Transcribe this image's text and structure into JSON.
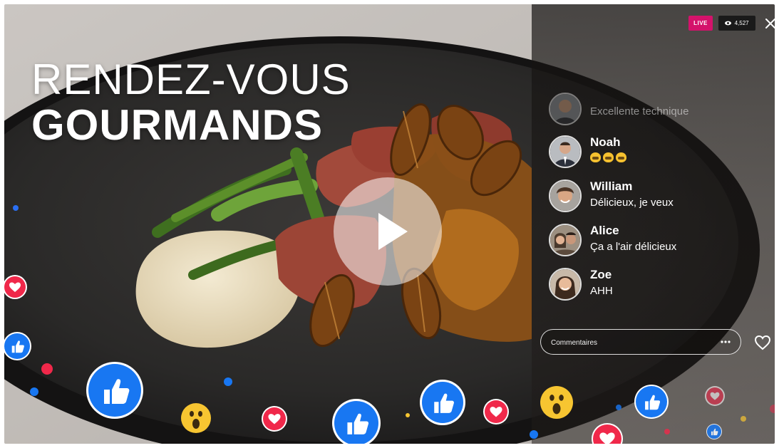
{
  "headline": {
    "line1": "RENDEZ-VOUS",
    "line2": "GOURMANDS"
  },
  "live_panel": {
    "live_badge": "LIVE",
    "viewer_count": "4,527",
    "comments": [
      {
        "name": "",
        "text": "Excellente technique",
        "avatar": "avatar-man-beard"
      },
      {
        "name": "Noah",
        "text": "",
        "emoji": [
          "grinning-emoji",
          "grinning-emoji",
          "grinning-emoji"
        ],
        "avatar": "avatar-man-suit"
      },
      {
        "name": "William",
        "text": "Délicieux, je veux",
        "avatar": "avatar-man-curly"
      },
      {
        "name": "Alice",
        "text": "Ça a l'air délicieux",
        "avatar": "avatar-couple"
      },
      {
        "name": "Zoe",
        "text": "AHH",
        "avatar": "avatar-woman"
      }
    ],
    "comment_placeholder": "Commentaires"
  },
  "icons": {
    "play": "play-icon",
    "close": "close-icon",
    "heart": "heart-icon",
    "more": "more-icon",
    "viewers": "eye-icon",
    "like_reaction": "thumbs-up-icon",
    "love_reaction": "heart-reaction-icon",
    "wow_reaction": "wow-emoji-icon"
  },
  "colors": {
    "live_badge": "#d4126b",
    "like_blue": "#1877f2",
    "love_red": "#f0284a",
    "wow_yellow": "#f7c531"
  }
}
